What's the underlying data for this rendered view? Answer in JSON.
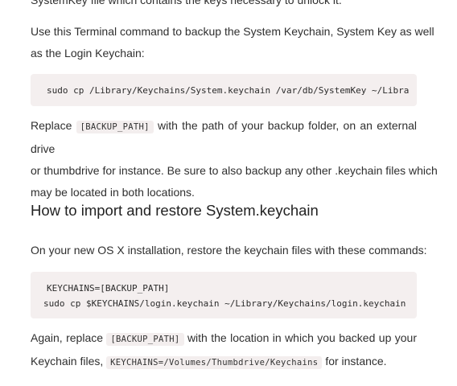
{
  "article": {
    "top_fragment": "SystemKey file which contains the keys necessary to unlock it.",
    "para1": {
      "line1": "Use this Terminal command to backup the System Keychain, System Key as well",
      "line2": "as the Login Keychain:"
    },
    "code1": {
      "line1": "sudo cp /Library/Keychains/System.keychain /var/db/SystemKey ~/Libra"
    },
    "para2": {
      "prefix": "Replace",
      "code": "[BACKUP_PATH]",
      "suffix": "with the path of your backup folder, on an external drive",
      "line2": "or thumbdrive for instance. Be sure to also backup any other .keychain files which",
      "line3": "may be located in both locations."
    },
    "heading": "How to import and restore System.keychain",
    "para3": "On your new OS X installation, restore the keychain files with these commands:",
    "code2": {
      "line1": "KEYCHAINS=[BACKUP_PATH]",
      "line2": "sudo cp $KEYCHAINS/login.keychain ~/Library/Keychains/login.keychain"
    },
    "para4": {
      "prefix": "Again, replace",
      "code1": "[BACKUP_PATH]",
      "suffix": "with the location in which you backed up your",
      "line2_prefix": "Keychain files,",
      "code2": "KEYCHAINS=/Volumes/Thumbdrive/Keychains",
      "line2_suffix": "for instance."
    }
  }
}
